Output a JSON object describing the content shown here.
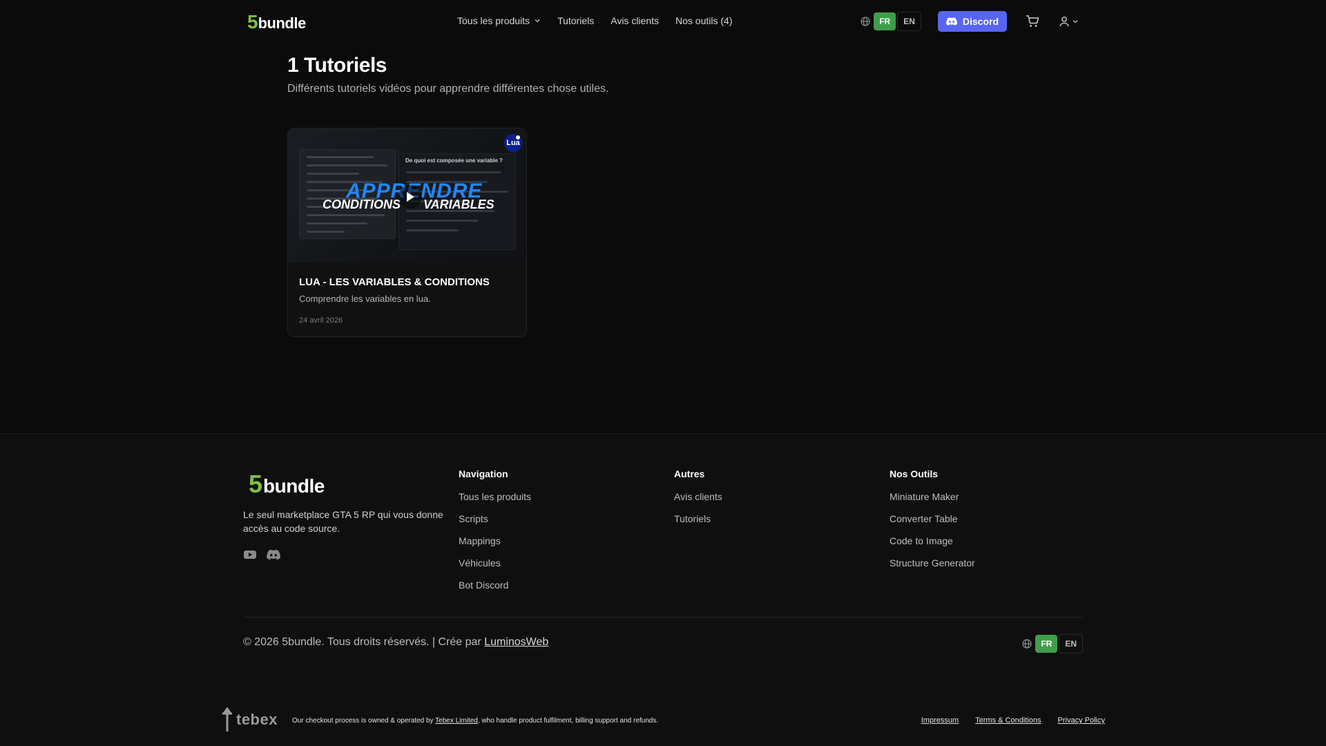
{
  "brand": {
    "number": "5",
    "name": "bundle"
  },
  "nav": {
    "items": [
      {
        "label": "Tous les produits",
        "has_dropdown": true
      },
      {
        "label": "Tutoriels",
        "has_dropdown": false
      },
      {
        "label": "Avis clients",
        "has_dropdown": false
      },
      {
        "label": "Nos outils (4)",
        "has_dropdown": false
      }
    ]
  },
  "header": {
    "lang": {
      "active": "FR",
      "other": "EN"
    },
    "discord_label": "Discord",
    "icons": [
      "globe-icon",
      "discord-icon",
      "cart-icon",
      "user-icon",
      "chevron-down-icon"
    ]
  },
  "page": {
    "title": "1 Tutoriels",
    "subtitle": "Différents tutoriels vidéos pour apprendre différentes chose utiles."
  },
  "tutorials": [
    {
      "thumb": {
        "badge": "Lua",
        "question": "De quoi est composée une variable ?",
        "line1": "APPRENDRE",
        "line2_left": "CONDITIONS",
        "line2_right": "VARIABLES"
      },
      "title": "LUA - LES VARIABLES & CONDITIONS",
      "description": "Comprendre les variables en lua.",
      "date": "24 avril 2026"
    }
  ],
  "footer": {
    "tagline": "Le seul marketplace GTA 5 RP qui vous donne accès au code source.",
    "social": [
      "youtube-icon",
      "discord-icon"
    ],
    "columns": [
      {
        "heading": "Navigation",
        "links": [
          "Tous les produits",
          "Scripts",
          "Mappings",
          "Véhicules",
          "Bot Discord"
        ]
      },
      {
        "heading": "Autres",
        "links": [
          "Avis clients",
          "Tutoriels"
        ]
      },
      {
        "heading": "Nos Outils",
        "links": [
          "Miniature Maker",
          "Converter Table",
          "Code to Image",
          "Structure Generator"
        ]
      }
    ],
    "copyright": "© 2026 5bundle. Tous droits réservés. | Crée par",
    "credit": "LuminosWeb",
    "lang": {
      "active": "FR",
      "other": "EN"
    }
  },
  "tebex": {
    "logo_text": "tebex",
    "note_before": "Our checkout process is owned & operated by",
    "note_link": "Tebex Limited",
    "note_after": ", who handle product fulfilment, billing support and refunds.",
    "legal_links": [
      "Impressum",
      "Terms & Conditions",
      "Privacy Policy"
    ]
  },
  "colors": {
    "background": "#0b0b0b",
    "accent_green": "#7cc142",
    "lang_active": "#3f9e4a",
    "discord": "#5865f2"
  }
}
